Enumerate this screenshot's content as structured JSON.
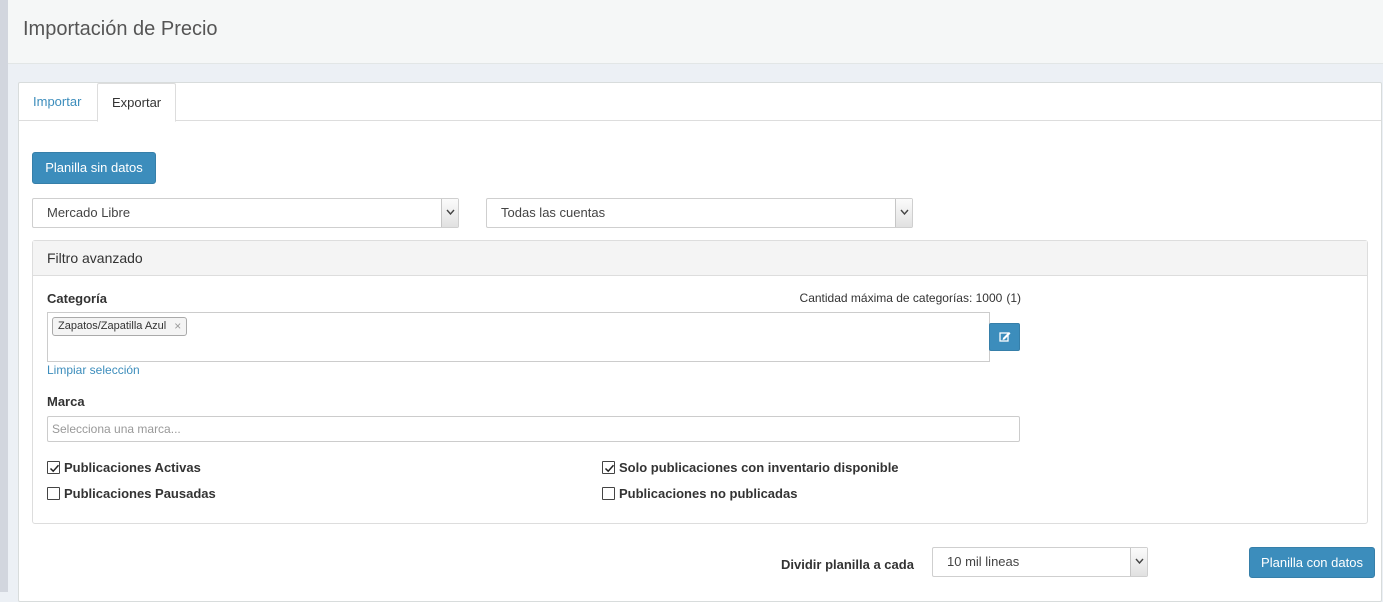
{
  "page": {
    "title": "Importación de Precio"
  },
  "tabs": [
    {
      "label": "Importar",
      "active": false
    },
    {
      "label": "Exportar",
      "active": true
    }
  ],
  "actions": {
    "blank_template_label": "Planilla sin datos",
    "data_template_label": "Planilla con datos"
  },
  "selects": {
    "marketplace": "Mercado Libre",
    "accounts": "Todas las cuentas"
  },
  "filter": {
    "title": "Filtro avanzado",
    "category": {
      "label": "Categoría",
      "max_text": "Cantidad máxima de categorías: 1000",
      "count_text": "(1)",
      "tags": [
        "Zapatos/Zapatilla Azul"
      ],
      "clear_label": "Limpiar selección"
    },
    "brand": {
      "label": "Marca",
      "placeholder": "Selecciona una marca..."
    },
    "checkboxes": {
      "active": {
        "label": "Publicaciones Activas",
        "checked": true
      },
      "paused": {
        "label": "Publicaciones Pausadas",
        "checked": false
      },
      "in_stock": {
        "label": "Solo publicaciones con inventario disponible",
        "checked": true
      },
      "unpublished": {
        "label": "Publicaciones no publicadas",
        "checked": false
      }
    }
  },
  "split": {
    "label": "Dividir planilla a cada",
    "value": "10 mil lineas"
  },
  "icons": {
    "caret": "chevron-down-icon",
    "edit": "edit-icon",
    "remove": "close-icon",
    "check": "check-icon"
  },
  "colors": {
    "primary": "#3c8dbc",
    "link": "#3c8dbc",
    "header_bg": "#f5f7f7"
  }
}
